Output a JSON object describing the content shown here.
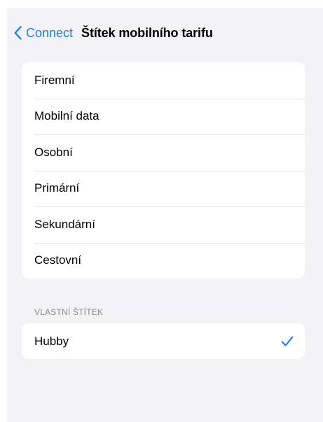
{
  "nav": {
    "back_label": "Connect",
    "title": "Štítek mobilního tarifu",
    "back_icon": "chevron-left-icon"
  },
  "labels": [
    "Firemní",
    "Mobilní data",
    "Osobní",
    "Primární",
    "Sekundární",
    "Cestovní"
  ],
  "custom_section": {
    "header": "VLASTNÍ ŠTÍTEK",
    "items": [
      {
        "label": "Hubby",
        "selected": true,
        "icon": "checkmark-icon"
      }
    ]
  },
  "colors": {
    "accent": "#1a7ef7",
    "background": "#f2f2f7",
    "cell": "#ffffff",
    "separator": "#e3e3e8",
    "section_header": "#8a8a8e"
  }
}
